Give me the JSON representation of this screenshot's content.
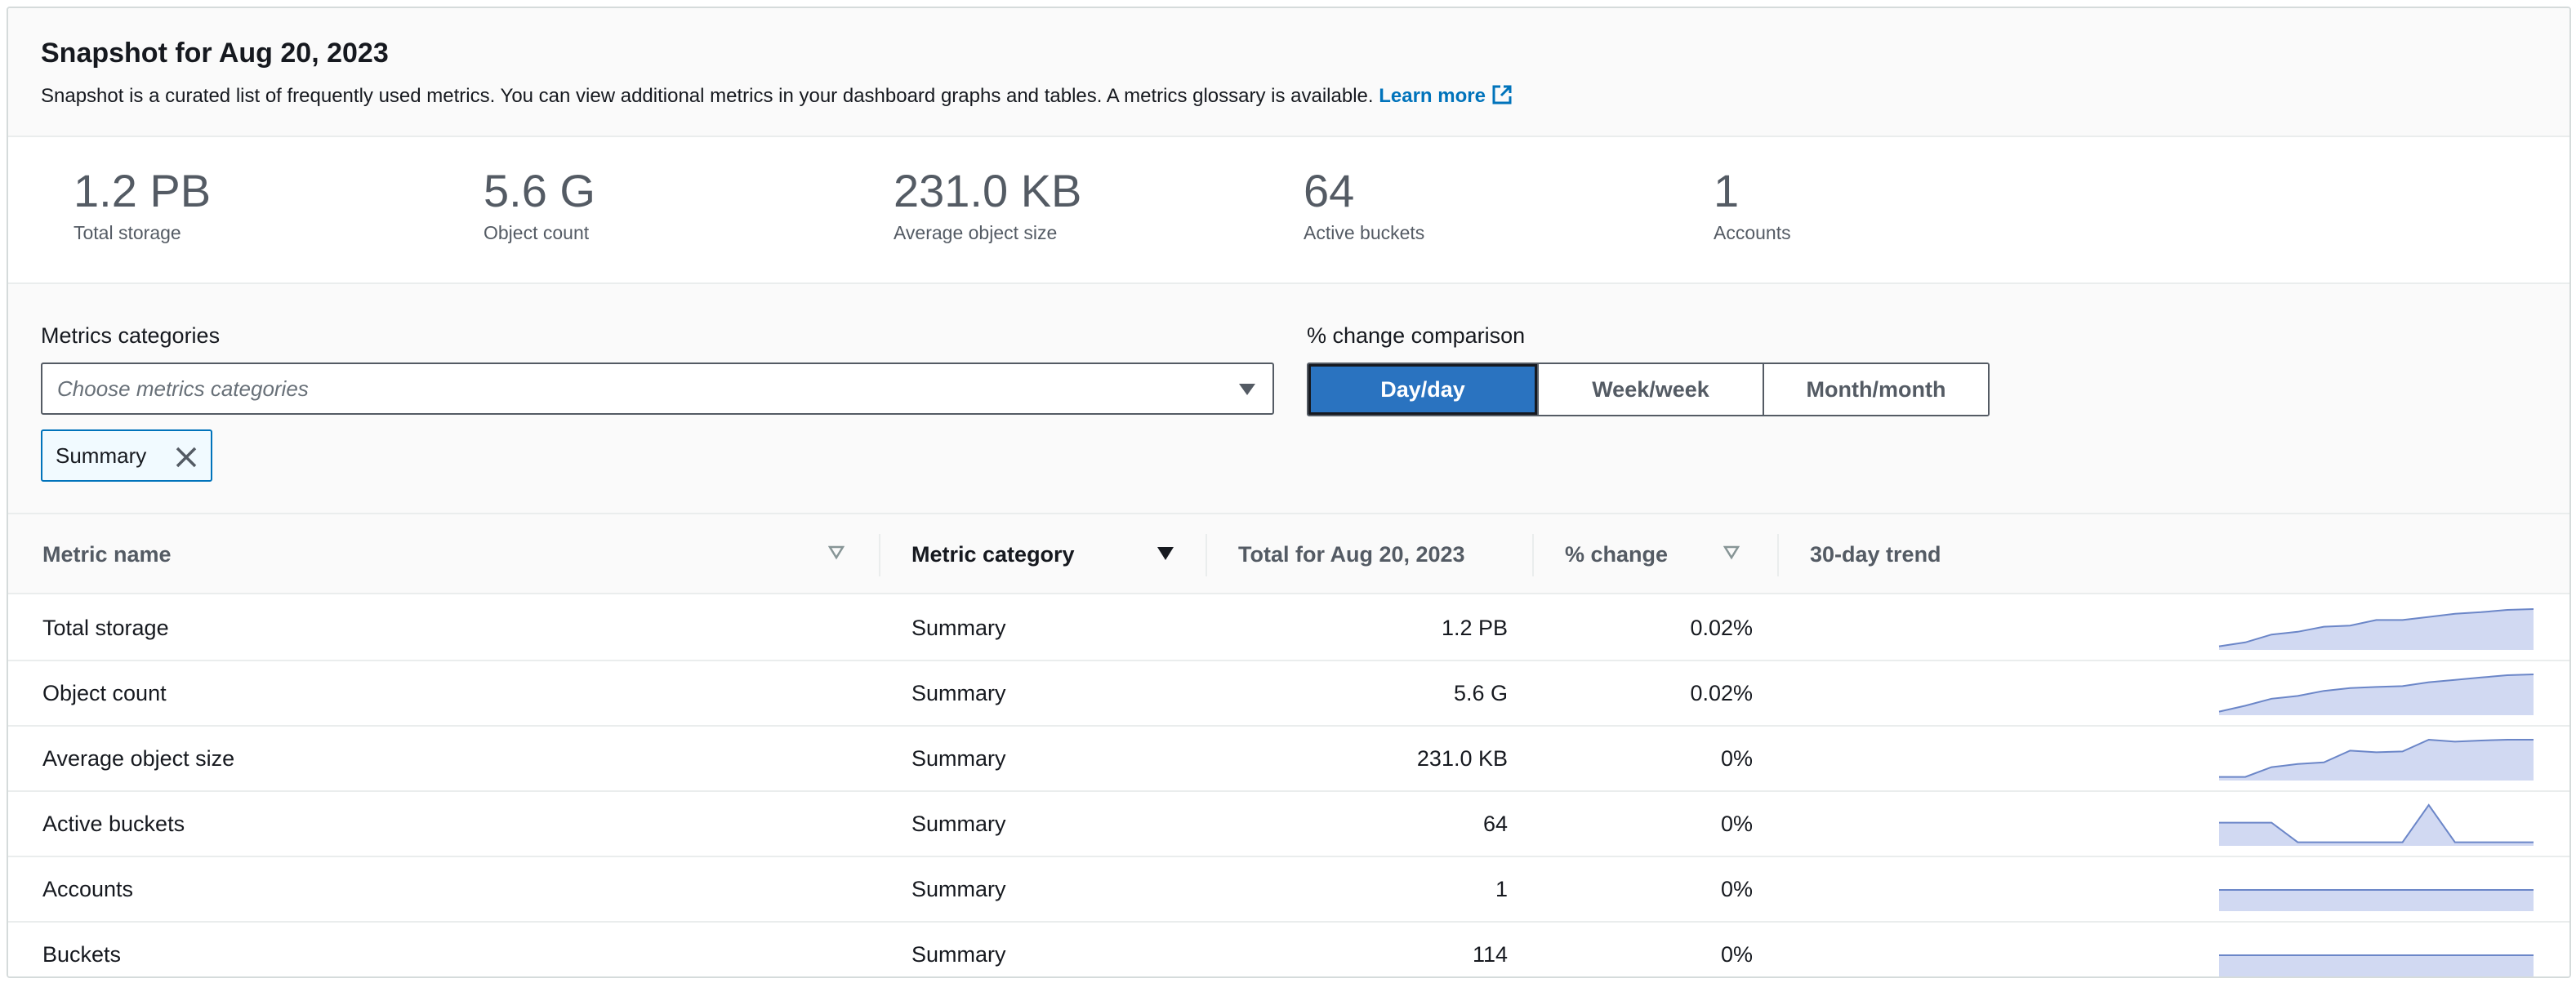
{
  "header": {
    "title": "Snapshot for Aug 20, 2023",
    "description": "Snapshot is a curated list of frequently used metrics. You can view additional metrics in your dashboard graphs and tables. A metrics glossary is available.",
    "learn_more": "Learn more",
    "learn_more_icon": "external-link-icon"
  },
  "kpis": [
    {
      "value": "1.2 PB",
      "label": "Total storage"
    },
    {
      "value": "5.6 G",
      "label": "Object count"
    },
    {
      "value": "231.0 KB",
      "label": "Average object size"
    },
    {
      "value": "64",
      "label": "Active buckets"
    },
    {
      "value": "1",
      "label": "Accounts"
    }
  ],
  "controls": {
    "metrics_label": "Metrics categories",
    "metrics_placeholder": "Choose metrics categories",
    "selected_token": "Summary",
    "comparison_label": "% change comparison",
    "comparison_options": [
      "Day/day",
      "Week/week",
      "Month/month"
    ],
    "comparison_selected": "Day/day"
  },
  "table": {
    "columns": [
      "Metric name",
      "Metric category",
      "Total for Aug 20, 2023",
      "% change",
      "30-day trend"
    ],
    "rows": [
      {
        "name": "Total storage",
        "category": "Summary",
        "total": "1.2 PB",
        "change": "0.02%",
        "trend": [
          0.05,
          0.15,
          0.35,
          0.42,
          0.55,
          0.58,
          0.72,
          0.72,
          0.8,
          0.88,
          0.92,
          0.98,
          1.0
        ]
      },
      {
        "name": "Object count",
        "category": "Summary",
        "total": "5.6 G",
        "change": "0.02%",
        "trend": [
          0.05,
          0.2,
          0.38,
          0.45,
          0.58,
          0.65,
          0.68,
          0.7,
          0.8,
          0.86,
          0.92,
          0.98,
          1.0
        ]
      },
      {
        "name": "Average object size",
        "category": "Summary",
        "total": "231.0 KB",
        "change": "0%",
        "trend": [
          0.05,
          0.05,
          0.3,
          0.38,
          0.42,
          0.72,
          0.68,
          0.7,
          1.0,
          0.95,
          0.98,
          1.0,
          1.0
        ]
      },
      {
        "name": "Active buckets",
        "category": "Summary",
        "total": "64",
        "change": "0%",
        "trend": [
          0.55,
          0.55,
          0.55,
          0.05,
          0.05,
          0.05,
          0.05,
          0.05,
          1.0,
          0.05,
          0.05,
          0.05,
          0.05
        ]
      },
      {
        "name": "Accounts",
        "category": "Summary",
        "total": "1",
        "change": "0%",
        "trend": [
          0.5,
          0.5,
          0.5,
          0.5,
          0.5,
          0.5,
          0.5,
          0.5,
          0.5,
          0.5,
          0.5,
          0.5,
          0.5
        ]
      },
      {
        "name": "Buckets",
        "category": "Summary",
        "total": "114",
        "change": "0%",
        "trend": [
          0.5,
          0.5,
          0.5,
          0.5,
          0.5,
          0.5,
          0.5,
          0.5,
          0.5,
          0.5,
          0.5,
          0.5,
          0.5
        ]
      }
    ]
  },
  "colors": {
    "accent": "#0073bb",
    "selected_button": "#2a73c0",
    "sparkline_fill": "#d1d9f2",
    "sparkline_stroke": "#6b86c8"
  }
}
